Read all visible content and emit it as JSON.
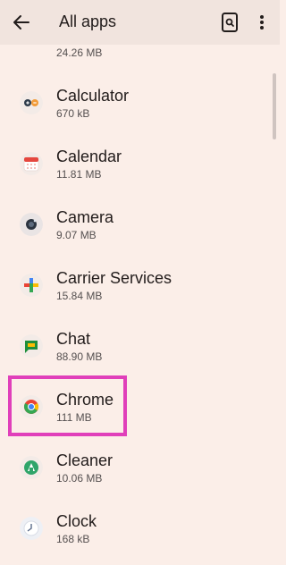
{
  "header": {
    "title": "All apps",
    "back_icon": "arrow-back-icon",
    "search_icon": "search-device-icon",
    "more_icon": "more-vert-icon"
  },
  "apps": [
    {
      "name": "",
      "size": "24.26 MB",
      "icon": "partial-app-icon"
    },
    {
      "name": "Calculator",
      "size": "670 kB",
      "icon": "calculator-icon"
    },
    {
      "name": "Calendar",
      "size": "11.81 MB",
      "icon": "calendar-icon"
    },
    {
      "name": "Camera",
      "size": "9.07 MB",
      "icon": "camera-icon"
    },
    {
      "name": "Carrier Services",
      "size": "15.84 MB",
      "icon": "carrier-services-icon"
    },
    {
      "name": "Chat",
      "size": "88.90 MB",
      "icon": "chat-icon"
    },
    {
      "name": "Chrome",
      "size": "111 MB",
      "icon": "chrome-icon"
    },
    {
      "name": "Cleaner",
      "size": "10.06 MB",
      "icon": "cleaner-icon"
    },
    {
      "name": "Clock",
      "size": "168 kB",
      "icon": "clock-icon"
    }
  ],
  "colors": {
    "background": "#fbeee8",
    "header": "#f1e4de",
    "highlight": "#e03fba"
  }
}
